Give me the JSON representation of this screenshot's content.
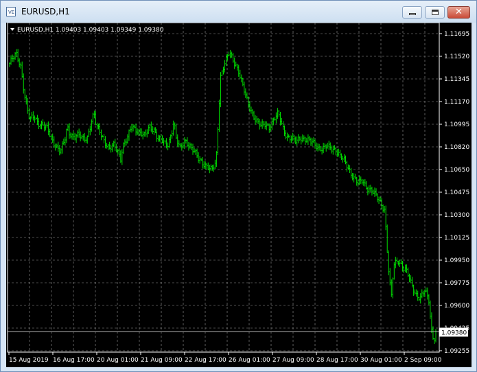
{
  "window": {
    "title": "EURUSD,H1",
    "app_icon_text": "VE"
  },
  "chart_data": {
    "type": "candlestick",
    "symbol_line": "EURUSD,H1  1.09403 1.09403 1.09349 1.09380",
    "current_price": 1.0938,
    "current_price_label": "1.09380",
    "ylim": [
      1.0922,
      1.1182
    ],
    "y_ticks": [
      "1.11695",
      "1.11520",
      "1.11345",
      "1.11170",
      "1.10995",
      "1.10820",
      "1.10650",
      "1.10475",
      "1.10300",
      "1.10125",
      "1.09950",
      "1.09775",
      "1.09600",
      "1.09425",
      "1.09255"
    ],
    "x_ticks": [
      "15 Aug 2019",
      "16 Aug 17:00",
      "20 Aug 01:00",
      "21 Aug 09:00",
      "22 Aug 17:00",
      "26 Aug 01:00",
      "27 Aug 09:00",
      "28 Aug 17:00",
      "30 Aug 01:00",
      "2 Sep 09:00"
    ],
    "grid": true,
    "bar_color": "#00e000",
    "grid_color": "#9a9a9a",
    "close_path": [
      [
        0,
        1.115
      ],
      [
        3,
        1.1157
      ],
      [
        5,
        1.1148
      ],
      [
        7,
        1.1122
      ],
      [
        9,
        1.1105
      ],
      [
        11,
        1.1108
      ],
      [
        13,
        1.1103
      ],
      [
        15,
        1.1101
      ],
      [
        17,
        1.1098
      ],
      [
        19,
        1.109
      ],
      [
        21,
        1.1085
      ],
      [
        23,
        1.108
      ],
      [
        25,
        1.109
      ],
      [
        26,
        1.11
      ],
      [
        27,
        1.1095
      ],
      [
        29,
        1.1092
      ],
      [
        31,
        1.1093
      ],
      [
        33,
        1.109
      ],
      [
        35,
        1.1092
      ],
      [
        37,
        1.1105
      ],
      [
        38,
        1.111
      ],
      [
        39,
        1.11
      ],
      [
        41,
        1.1095
      ],
      [
        43,
        1.1088
      ],
      [
        45,
        1.1082
      ],
      [
        47,
        1.1085
      ],
      [
        49,
        1.108
      ],
      [
        50,
        1.1075
      ],
      [
        51,
        1.1085
      ],
      [
        53,
        1.109
      ],
      [
        55,
        1.11
      ],
      [
        57,
        1.1098
      ],
      [
        59,
        1.1095
      ],
      [
        61,
        1.1092
      ],
      [
        63,
        1.11
      ],
      [
        65,
        1.1098
      ],
      [
        67,
        1.109
      ],
      [
        69,
        1.1088
      ],
      [
        71,
        1.1085
      ],
      [
        73,
        1.1095
      ],
      [
        74,
        1.1105
      ],
      [
        75,
        1.109
      ],
      [
        77,
        1.1082
      ],
      [
        79,
        1.109
      ],
      [
        81,
        1.1085
      ],
      [
        83,
        1.108
      ],
      [
        85,
        1.1075
      ],
      [
        87,
        1.1072
      ],
      [
        89,
        1.1068
      ],
      [
        91,
        1.1065
      ],
      [
        93,
        1.1072
      ],
      [
        95,
        1.114
      ],
      [
        97,
        1.115
      ],
      [
        99,
        1.1158
      ],
      [
        101,
        1.1152
      ],
      [
        103,
        1.1145
      ],
      [
        105,
        1.1132
      ],
      [
        107,
        1.112
      ],
      [
        109,
        1.1112
      ],
      [
        111,
        1.1105
      ],
      [
        113,
        1.11
      ],
      [
        115,
        1.1102
      ],
      [
        117,
        1.11
      ],
      [
        119,
        1.1105
      ],
      [
        121,
        1.111
      ],
      [
        123,
        1.11
      ],
      [
        125,
        1.1092
      ],
      [
        127,
        1.109
      ],
      [
        129,
        1.1088
      ],
      [
        131,
        1.1092
      ],
      [
        133,
        1.109
      ],
      [
        135,
        1.1088
      ],
      [
        137,
        1.1087
      ],
      [
        139,
        1.1084
      ],
      [
        141,
        1.1082
      ],
      [
        143,
        1.1084
      ],
      [
        145,
        1.1083
      ],
      [
        147,
        1.1082
      ],
      [
        149,
        1.1076
      ],
      [
        151,
        1.1072
      ],
      [
        153,
        1.1066
      ],
      [
        155,
        1.106
      ],
      [
        157,
        1.1055
      ],
      [
        159,
        1.1057
      ],
      [
        161,
        1.1052
      ],
      [
        163,
        1.105
      ],
      [
        165,
        1.1045
      ],
      [
        167,
        1.104
      ],
      [
        169,
        1.1035
      ],
      [
        170,
        1.1005
      ],
      [
        171,
        1.098
      ],
      [
        172,
        1.0965
      ],
      [
        173,
        1.099
      ],
      [
        175,
        1.0995
      ],
      [
        177,
        1.099
      ],
      [
        179,
        1.0985
      ],
      [
        181,
        1.0975
      ],
      [
        183,
        1.0968
      ],
      [
        185,
        1.0965
      ],
      [
        187,
        1.097
      ],
      [
        189,
        1.0962
      ],
      [
        190,
        1.094
      ],
      [
        191,
        1.0932
      ],
      [
        192,
        1.0938
      ]
    ]
  }
}
